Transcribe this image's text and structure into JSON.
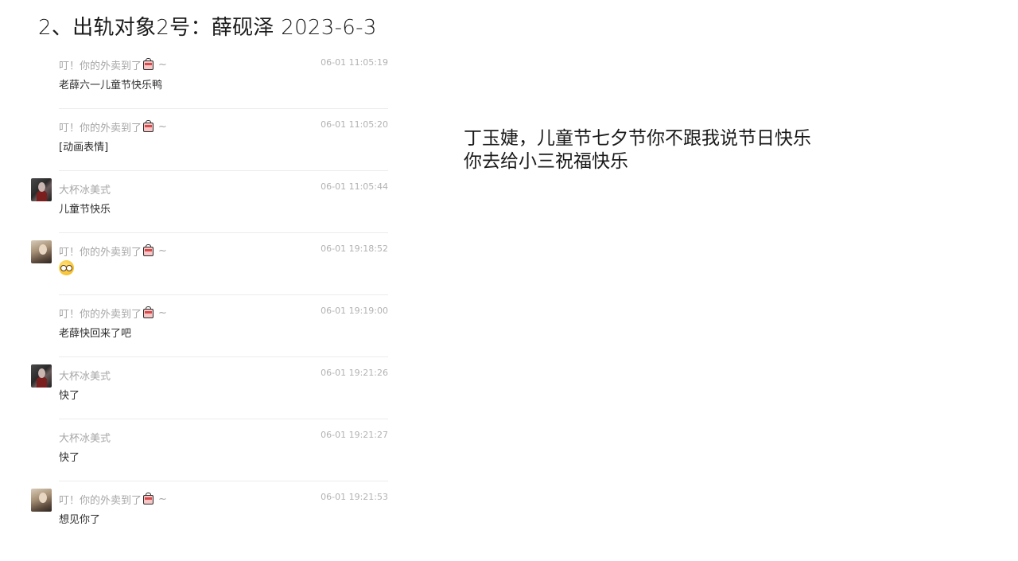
{
  "page_title": "2、出轨对象2号：薛砚泽  2023-6-3",
  "messages": [
    {
      "sender": "叮！你的外卖到了",
      "has_bag": true,
      "time": "06-01 11:05:19",
      "text": "老薛六一儿童节快乐鸭",
      "avatar": ""
    },
    {
      "sender": "叮！你的外卖到了",
      "has_bag": true,
      "time": "06-01 11:05:20",
      "text": "[动画表情]",
      "avatar": ""
    },
    {
      "sender": "大杯冰美式",
      "has_bag": false,
      "time": "06-01 11:05:44",
      "text": "儿童节快乐",
      "avatar": "a"
    },
    {
      "sender": "叮！你的外卖到了",
      "has_bag": true,
      "time": "06-01 19:18:52",
      "text": "",
      "emoji": "pleading-face-emoji",
      "avatar": "b"
    },
    {
      "sender": "叮！你的外卖到了",
      "has_bag": true,
      "time": "06-01 19:19:00",
      "text": "老薛快回来了吧",
      "avatar": ""
    },
    {
      "sender": "大杯冰美式",
      "has_bag": false,
      "time": "06-01 19:21:26",
      "text": "快了",
      "avatar": "a"
    },
    {
      "sender": "大杯冰美式",
      "has_bag": false,
      "time": "06-01 19:21:27",
      "text": "快了",
      "avatar": ""
    },
    {
      "sender": "叮！你的外卖到了",
      "has_bag": true,
      "time": "06-01 19:21:53",
      "text": "想见你了",
      "avatar": "b"
    }
  ],
  "tilde": "~",
  "note": {
    "line1": "丁玉婕，儿童节七夕节你不跟我说节日快乐",
    "line2": "你去给小三祝福快乐"
  },
  "colors": {
    "meta": "#a7a7a7",
    "text": "#2d2d2d",
    "divider": "#ececec"
  }
}
